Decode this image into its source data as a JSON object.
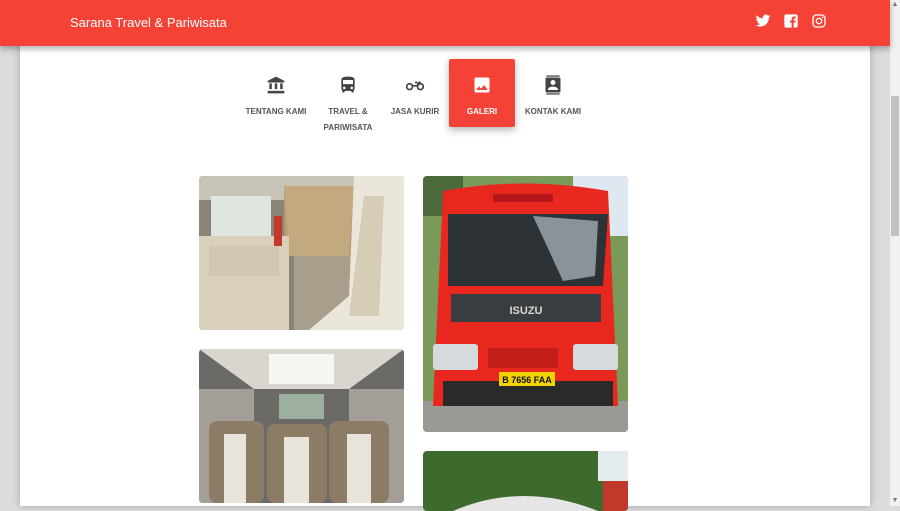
{
  "header": {
    "brand": "Sarana Travel & Pariwisata",
    "social": [
      "twitter-icon",
      "facebook-icon",
      "instagram-icon"
    ],
    "background": "#f44336"
  },
  "tabs": [
    {
      "label": "TENTANG KAMI",
      "icon": "bank-icon",
      "active": false
    },
    {
      "label": "TRAVEL & PARIWISATA",
      "icon": "bus-icon",
      "active": false
    },
    {
      "label": "JASA KURIR",
      "icon": "motorcycle-icon",
      "active": false
    },
    {
      "label": "GALERI",
      "icon": "image-icon",
      "active": true
    },
    {
      "label": "KONTAK KAMI",
      "icon": "contact-icon",
      "active": false
    }
  ],
  "gallery": {
    "plate_text": "B 7656 FAA",
    "truck_brand": "ISUZU"
  },
  "colors": {
    "accent": "#f44336"
  }
}
